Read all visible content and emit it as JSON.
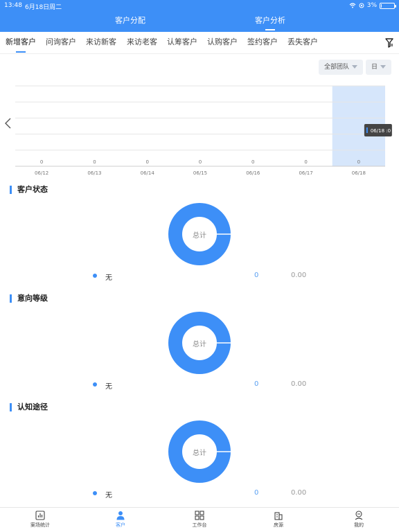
{
  "status_bar": {
    "time": "13:48",
    "date": "6月18日周二",
    "battery_text": "3%",
    "battery_level": 0.03
  },
  "header": {
    "tabs": [
      {
        "label": "客户分配",
        "active": false
      },
      {
        "label": "客户分析",
        "active": true
      }
    ]
  },
  "category_tabs": [
    {
      "label": "新增客户",
      "active": true
    },
    {
      "label": "问询客户",
      "active": false
    },
    {
      "label": "来访新客",
      "active": false
    },
    {
      "label": "来访老客",
      "active": false
    },
    {
      "label": "认筹客户",
      "active": false
    },
    {
      "label": "认购客户",
      "active": false
    },
    {
      "label": "签约客户",
      "active": false
    },
    {
      "label": "丢失客户",
      "active": false
    }
  ],
  "filters": {
    "team": "全部团队",
    "period": "日"
  },
  "chart_data": {
    "type": "bar",
    "categories": [
      "06/12",
      "06/13",
      "06/14",
      "06/15",
      "06/16",
      "06/17",
      "06/18"
    ],
    "values": [
      0,
      0,
      0,
      0,
      0,
      0,
      0
    ],
    "highlighted_category": "06/18",
    "tooltip": "06/18 :0",
    "grid": true
  },
  "sections": [
    {
      "title": "客户状态",
      "center_label": "总计",
      "legend": [
        {
          "name": "无",
          "count": "0",
          "percent": "0.00"
        }
      ]
    },
    {
      "title": "意向等级",
      "center_label": "总计",
      "legend": [
        {
          "name": "无",
          "count": "0",
          "percent": "0.00"
        }
      ]
    },
    {
      "title": "认知途径",
      "center_label": "总计",
      "legend": [
        {
          "name": "无",
          "count": "0",
          "percent": "0.00"
        }
      ]
    }
  ],
  "bottom_nav": [
    {
      "label": "案场统计",
      "icon": "bar-chart-icon",
      "active": false
    },
    {
      "label": "客户",
      "icon": "person-icon",
      "active": true
    },
    {
      "label": "工作台",
      "icon": "grid-icon",
      "active": false
    },
    {
      "label": "房源",
      "icon": "building-icon",
      "active": false
    },
    {
      "label": "我的",
      "icon": "profile-icon",
      "active": false
    }
  ],
  "colors": {
    "primary": "#3d8ff7",
    "highlight_band": "#d6e6fb",
    "tooltip_bg": "#444444"
  }
}
